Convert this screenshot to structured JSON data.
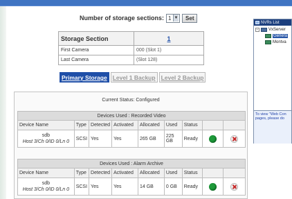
{
  "storage_sections": {
    "label": "Number of storage sections:",
    "value": "1",
    "set_label": "Set"
  },
  "storage_section": {
    "title": "Storage Section",
    "number": "1",
    "rows": [
      {
        "label": "First Camera",
        "value": "000 (Slot 1)"
      },
      {
        "label": "Last Camera",
        "value": "(Slot 128)"
      }
    ]
  },
  "tabs": [
    {
      "label": "Primary Storage",
      "active": true
    },
    {
      "label": "Level 1 Backup",
      "active": false
    },
    {
      "label": "Level 2 Backup",
      "active": false
    }
  ],
  "current_status": "Current Status: Configured",
  "column_headers": [
    "Device Name",
    "Type",
    "Detected",
    "Activated",
    "Allocated",
    "Used",
    "Status"
  ],
  "device_groups": [
    {
      "title": "Devices Used : Recorded Video",
      "row": {
        "name": "sdb",
        "path": "Host 3/Ch 0/ID 0/Ln 0",
        "type": "SCSI",
        "detected": "Yes",
        "activated": "Yes",
        "allocated": "265 GB",
        "used": "225 GB",
        "status": "Ready"
      }
    },
    {
      "title": "Devices Used : Alarm Archive",
      "row": {
        "name": "sdb",
        "path": "Host 3/Ch 0/ID 0/Ln 0",
        "type": "SCSI",
        "detected": "Yes",
        "activated": "Yes",
        "allocated": "14 GB",
        "used": "0 GB",
        "status": "Ready"
      }
    }
  ],
  "nvr_panel": {
    "title": "NVRs List",
    "server": "VxServer",
    "items": [
      "Genera",
      "Montva"
    ],
    "note_lines": [
      "To view \"Web Con",
      "pages, please do"
    ]
  },
  "colors": {
    "top_bar": "#3f74c2",
    "active_tab": "#1f4fa8",
    "ready_green": "#1e9a3a",
    "delete_red": "#c62828"
  }
}
